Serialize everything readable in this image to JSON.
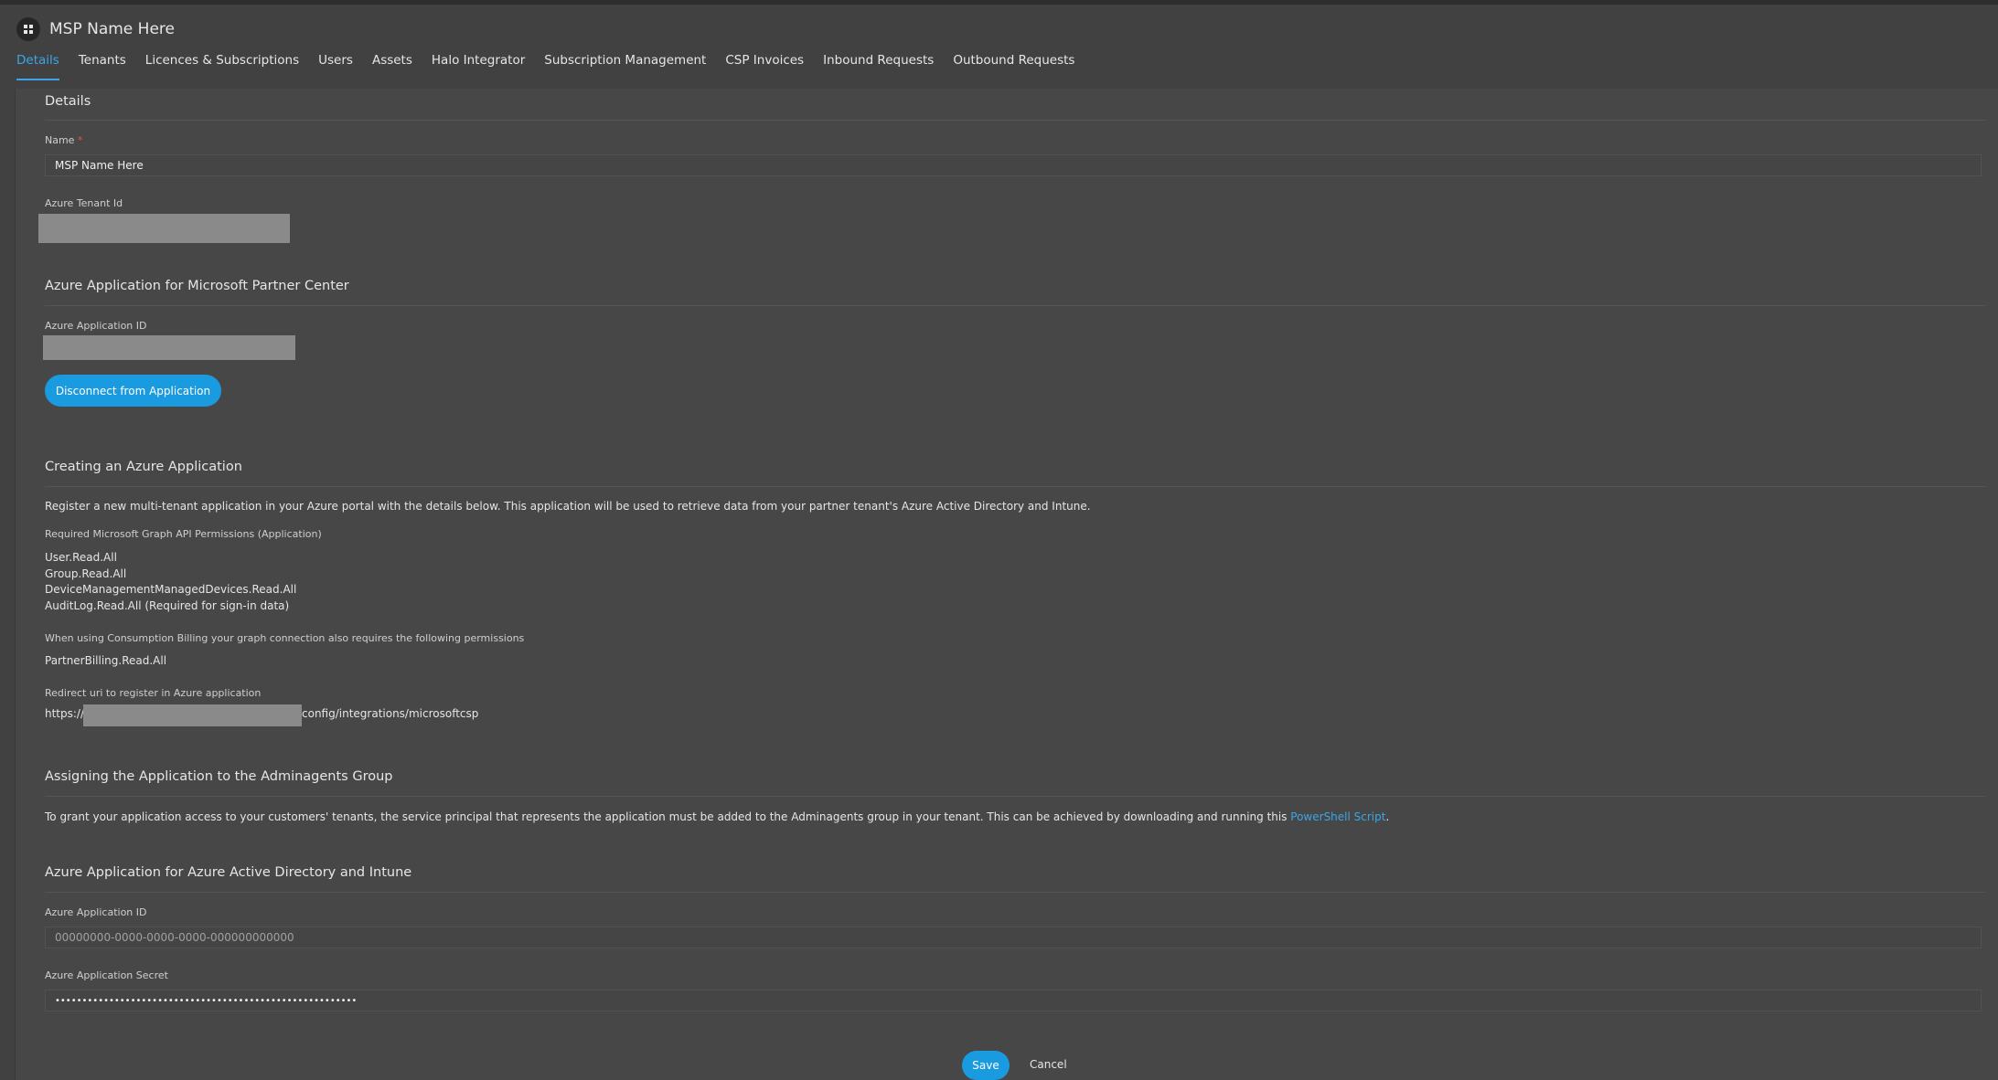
{
  "app": {
    "title": "MSP Name Here"
  },
  "tabs": [
    {
      "label": "Details"
    },
    {
      "label": "Tenants"
    },
    {
      "label": "Licences & Subscriptions"
    },
    {
      "label": "Users"
    },
    {
      "label": "Assets"
    },
    {
      "label": "Halo Integrator"
    },
    {
      "label": "Subscription Management"
    },
    {
      "label": "CSP Invoices"
    },
    {
      "label": "Inbound Requests"
    },
    {
      "label": "Outbound Requests"
    }
  ],
  "details": {
    "title": "Details",
    "name_label": "Name",
    "name_required": "*",
    "name_value": "MSP Name Here",
    "tenant_label": "Azure Tenant Id"
  },
  "partner_center": {
    "title": "Azure Application for Microsoft Partner Center",
    "app_id_label": "Azure Application ID",
    "disconnect_label": "Disconnect from Application"
  },
  "creating": {
    "title": "Creating an Azure Application",
    "intro": "Register a new multi-tenant application in your Azure portal with the details below. This application will be used to retrieve data from your partner tenant's Azure Active Directory and Intune.",
    "graph_label": "Required Microsoft Graph API Permissions (Application)",
    "permissions": [
      "User.Read.All",
      "Group.Read.All",
      "DeviceManagementManagedDevices.Read.All",
      "AuditLog.Read.All (Required for sign-in data)"
    ],
    "billing_label": "When using Consumption Billing your graph connection also requires the following permissions",
    "billing_permission": "PartnerBilling.Read.All",
    "redirect_label": "Redirect uri to register in Azure application",
    "redirect_prefix": "https://",
    "redirect_suffix": "config/integrations/microsoftcsp"
  },
  "adminagents": {
    "title": "Assigning the Application to the Adminagents Group",
    "text": "To grant your application access to your customers' tenants, the service principal that represents the application must be added to the Adminagents group in your tenant. This can be achieved by downloading and running this ",
    "link": "PowerShell Script",
    "end": "."
  },
  "aad": {
    "title": "Azure Application for Azure Active Directory and Intune",
    "app_id_label": "Azure Application ID",
    "app_id_placeholder": "00000000-0000-0000-0000-000000000000",
    "secret_label": "Azure Application Secret",
    "secret_value": "••••••••••••••••••••••••••••••••••••••••••••••••••••••••"
  },
  "footer": {
    "save": "Save",
    "cancel": "Cancel"
  },
  "colors": {
    "accent": "#1a9be0",
    "background": "#414141",
    "panel": "#474747"
  }
}
